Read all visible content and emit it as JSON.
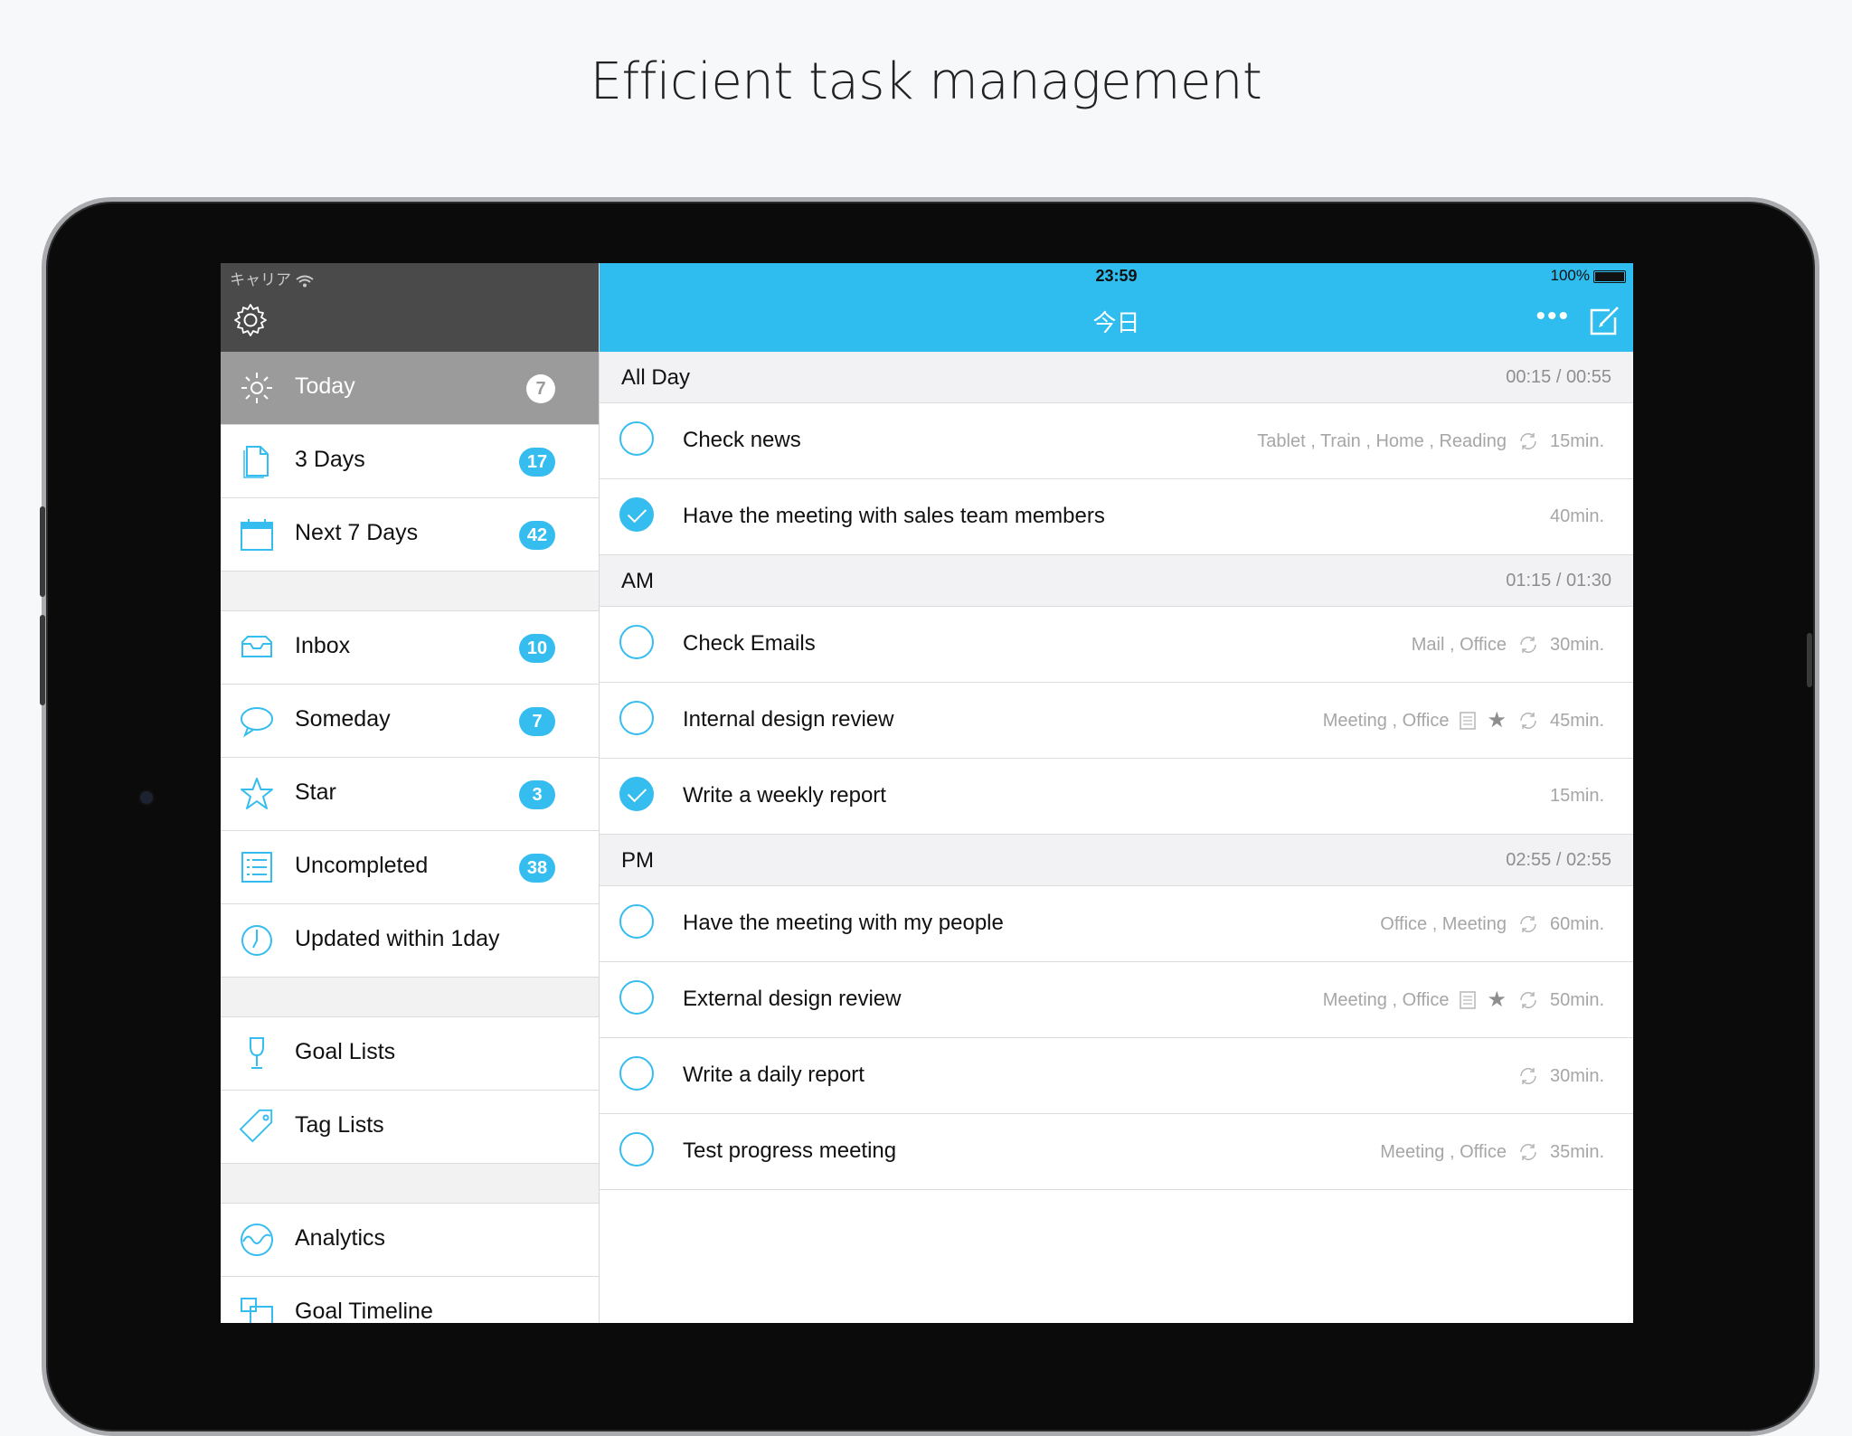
{
  "headline": "Efficient task management",
  "status": {
    "carrier": "キャリア",
    "time": "23:59",
    "battery": "100%"
  },
  "nav": {
    "title": "今日",
    "more_label": "•••"
  },
  "sidebar": {
    "groups": [
      [
        {
          "label": "Today",
          "badge": "7",
          "icon": "sun-icon",
          "active": true
        },
        {
          "label": "3 Days",
          "badge": "17",
          "icon": "document-icon"
        },
        {
          "label": "Next 7 Days",
          "badge": "42",
          "icon": "calendar-icon"
        }
      ],
      [
        {
          "label": "Inbox",
          "badge": "10",
          "icon": "inbox-icon"
        },
        {
          "label": "Someday",
          "badge": "7",
          "icon": "speech-bubble-icon"
        },
        {
          "label": "Star",
          "badge": "3",
          "icon": "star-icon"
        },
        {
          "label": "Uncompleted",
          "badge": "38",
          "icon": "checklist-icon"
        },
        {
          "label": "Updated within 1day",
          "badge": "",
          "icon": "clock-icon"
        }
      ],
      [
        {
          "label": "Goal Lists",
          "badge": "",
          "icon": "wine-glass-icon"
        },
        {
          "label": "Tag Lists",
          "badge": "",
          "icon": "tag-icon"
        }
      ],
      [
        {
          "label": "Analytics",
          "badge": "",
          "icon": "analytics-icon"
        },
        {
          "label": "Goal Timeline",
          "badge": "",
          "icon": "timeline-icon"
        }
      ]
    ]
  },
  "sections": [
    {
      "name": "All Day",
      "time": "00:15 / 00:55",
      "tasks": [
        {
          "title": "Check news",
          "tags": "Tablet , Train , Home , Reading",
          "note": false,
          "star": false,
          "repeat": true,
          "duration": "15min.",
          "done": false
        },
        {
          "title": "Have the meeting with sales team members",
          "tags": "",
          "note": false,
          "star": false,
          "repeat": false,
          "duration": "40min.",
          "done": true
        }
      ]
    },
    {
      "name": "AM",
      "time": "01:15 / 01:30",
      "tasks": [
        {
          "title": "Check Emails",
          "tags": "Mail , Office",
          "note": false,
          "star": false,
          "repeat": true,
          "duration": "30min.",
          "done": false
        },
        {
          "title": "Internal design review",
          "tags": "Meeting , Office",
          "note": true,
          "star": true,
          "repeat": true,
          "duration": "45min.",
          "done": false
        },
        {
          "title": "Write a weekly report",
          "tags": "",
          "note": false,
          "star": false,
          "repeat": false,
          "duration": "15min.",
          "done": true
        }
      ]
    },
    {
      "name": "PM",
      "time": "02:55 / 02:55",
      "tasks": [
        {
          "title": "Have the meeting with my people",
          "tags": "Office , Meeting",
          "note": false,
          "star": false,
          "repeat": true,
          "duration": "60min.",
          "done": false
        },
        {
          "title": "External design review",
          "tags": "Meeting , Office",
          "note": true,
          "star": true,
          "repeat": true,
          "duration": "50min.",
          "done": false
        },
        {
          "title": "Write a daily report",
          "tags": "",
          "note": false,
          "star": false,
          "repeat": true,
          "duration": "30min.",
          "done": false
        },
        {
          "title": "Test progress meeting",
          "tags": "Meeting , Office",
          "note": false,
          "star": false,
          "repeat": true,
          "duration": "35min.",
          "done": false
        }
      ]
    }
  ],
  "colors": {
    "accent": "#2ebdee",
    "badge": "#36bdf0",
    "sidebar_header": "#4a4a4a",
    "active_item": "#9b9b9b"
  }
}
